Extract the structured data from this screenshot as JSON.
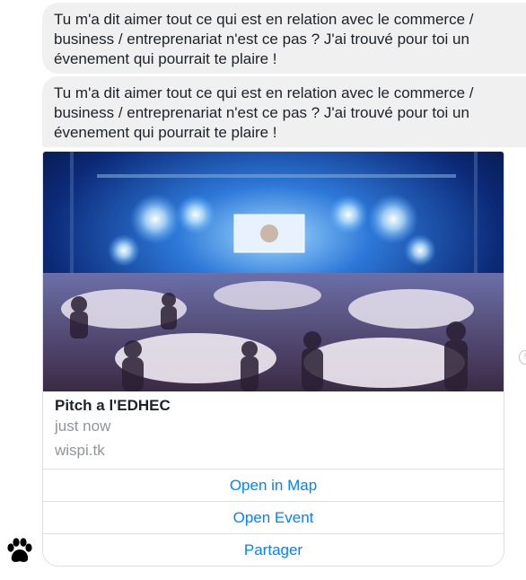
{
  "messages": [
    {
      "text": "Tu m'a dit aimer tout ce qui est en relation avec le commerce / business / entreprenariat n'est ce pas ? J'ai trouvé pour toi un évenement qui pourrait te plaire !"
    },
    {
      "text": "Tu m'a dit aimer tout ce qui est en relation avec le commerce / business / entreprenariat n'est ce pas ? J'ai trouvé pour toi un évenement qui pourrait te plaire !"
    }
  ],
  "card": {
    "image_icon": "event-photo",
    "title": "Pitch a l'EDHEC",
    "subtitle": "just now",
    "url": "wispi.tk",
    "buttons": [
      {
        "label": "Open in Map"
      },
      {
        "label": "Open Event"
      },
      {
        "label": "Partager"
      }
    ]
  },
  "avatar_icon": "paw-icon",
  "colors": {
    "bubble_bg": "#f1f0f0",
    "link": "#0084ff",
    "muted": "#90949c",
    "border": "#dddfe2"
  }
}
